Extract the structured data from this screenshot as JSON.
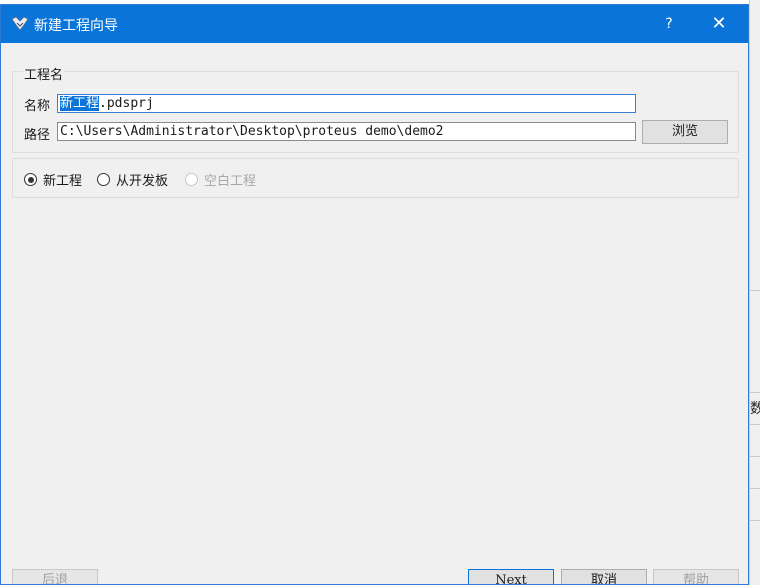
{
  "window": {
    "title": "新建工程向导",
    "help_label": "?",
    "close_label": "✕"
  },
  "project_group": {
    "title": "工程名",
    "name_label": "名称",
    "name_selected": "新工程",
    "name_rest": ".pdsprj",
    "path_label": "路径",
    "path_value": "C:\\Users\\Administrator\\Desktop\\proteus demo\\demo2",
    "browse_label": "浏览"
  },
  "template_options": [
    {
      "label": "新工程",
      "checked": true,
      "enabled": true
    },
    {
      "label": "从开发板",
      "checked": false,
      "enabled": true
    },
    {
      "label": "空白工程",
      "checked": false,
      "enabled": false
    }
  ],
  "footer": {
    "back_label": "后退",
    "next_label": "Next",
    "cancel_label": "取消",
    "help_label": "帮助"
  },
  "background_window": {
    "visible_text": "数"
  }
}
